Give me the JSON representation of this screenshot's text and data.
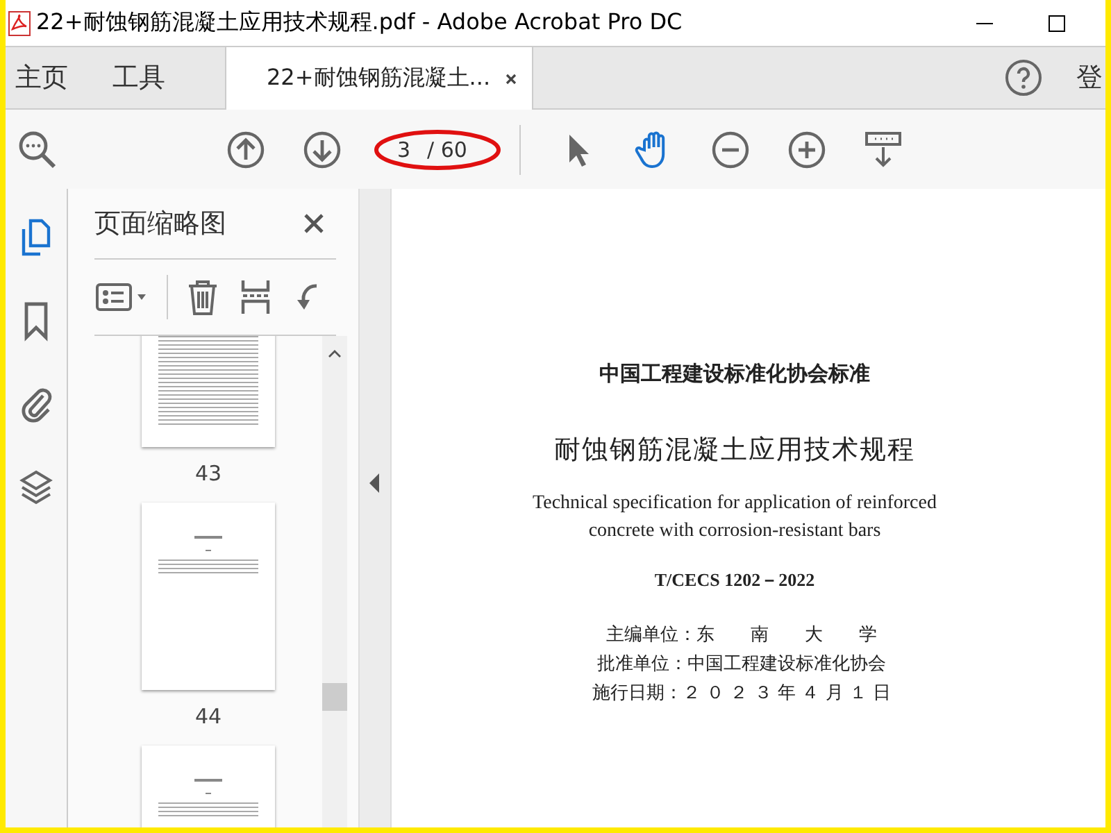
{
  "window": {
    "title": "22+耐蚀钢筋混凝土应用技术规程.pdf - Adobe Acrobat Pro DC"
  },
  "nav_tabs": [
    {
      "kind": "nav",
      "label": "主页",
      "selected": false
    },
    {
      "kind": "nav",
      "label": "工具",
      "selected": false
    },
    {
      "kind": "document",
      "label": "22+耐蚀钢筋混凝土...",
      "selected": true
    }
  ],
  "account": {
    "label": "登"
  },
  "page_nav": {
    "current": "3",
    "total": "/ 60",
    "highlighted": true
  },
  "tools": [
    {
      "kind": "select",
      "selected": false
    },
    {
      "kind": "hand",
      "selected": true
    },
    {
      "kind": "zoom-out",
      "selected": false
    },
    {
      "kind": "zoom-in",
      "selected": false
    },
    {
      "kind": "keyboard",
      "selected": false
    }
  ],
  "side_rail": [
    {
      "kind": "pages",
      "selected": true
    },
    {
      "kind": "bookmark",
      "selected": false
    },
    {
      "kind": "attachment",
      "selected": false
    },
    {
      "kind": "layers",
      "selected": false
    }
  ],
  "thumbnail_panel": {
    "title": "页面缩略图",
    "thumbnails": [
      {
        "kind": "dense",
        "label": "43"
      },
      {
        "kind": "heading",
        "label": "44"
      },
      {
        "kind": "heading"
      }
    ]
  },
  "document": {
    "lines": [
      {
        "kind": "org",
        "text": "中国工程建设标准化协会标准"
      },
      {
        "kind": "title",
        "text": "耐蚀钢筋混凝土应用技术规程"
      },
      {
        "kind": "english",
        "text": "Technical specification for application of reinforced"
      },
      {
        "kind": "english",
        "text": "concrete with corrosion-resistant bars"
      },
      {
        "kind": "code",
        "text": "T/CECS 1202－2022"
      },
      {
        "kind": "info",
        "text": "主编单位：东　　南　　大　　学"
      },
      {
        "kind": "info",
        "text": "批准单位：中国工程建设标准化协会"
      },
      {
        "kind": "info",
        "text": "施行日期：２ ０ ２ ３ 年 ４ 月 １ 日"
      }
    ]
  }
}
